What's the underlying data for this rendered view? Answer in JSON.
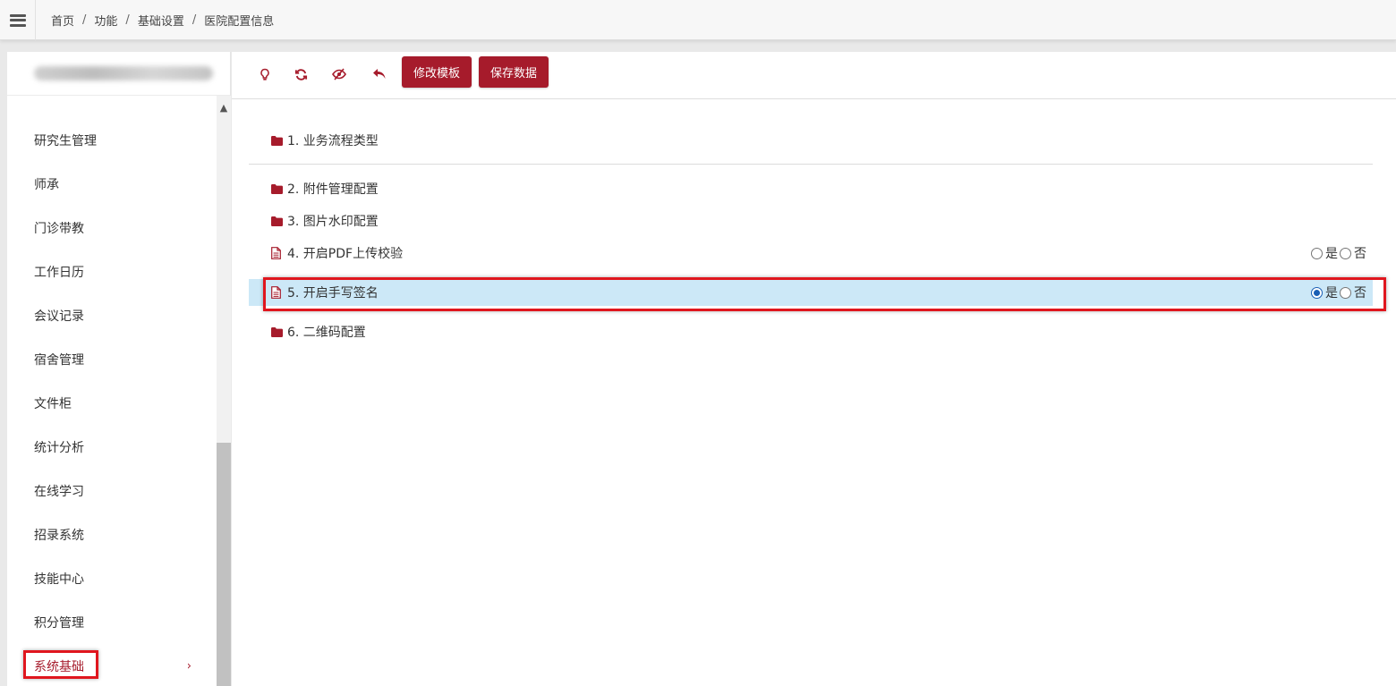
{
  "breadcrumb": [
    {
      "label": "首页"
    },
    {
      "label": "功能"
    },
    {
      "label": "基础设置"
    },
    {
      "label": "医院配置信息"
    }
  ],
  "breadcrumb_separator": "/",
  "sidebar": {
    "items": [
      {
        "label": "研究生管理"
      },
      {
        "label": "师承"
      },
      {
        "label": "门诊带教"
      },
      {
        "label": "工作日历"
      },
      {
        "label": "会议记录"
      },
      {
        "label": "宿舍管理"
      },
      {
        "label": "文件柜"
      },
      {
        "label": "统计分析"
      },
      {
        "label": "在线学习"
      },
      {
        "label": "招录系统"
      },
      {
        "label": "技能中心"
      },
      {
        "label": "积分管理"
      },
      {
        "label": "系统基础",
        "active": true
      }
    ],
    "active_chevron": "›",
    "scroll_up": "▲"
  },
  "toolbar": {
    "icons": [
      "lightbulb-icon",
      "refresh-icon",
      "eye-off-icon",
      "undo-icon"
    ],
    "edit_template_label": "修改模板",
    "save_data_label": "保存数据"
  },
  "tree": {
    "items": [
      {
        "label": "1. 业务流程类型",
        "icon": "folder-icon"
      },
      {
        "label": "2. 附件管理配置",
        "icon": "folder-icon"
      },
      {
        "label": "3. 图片水印配置",
        "icon": "folder-icon"
      },
      {
        "label": "4. 开启PDF上传校验",
        "icon": "document-icon",
        "yes": "是",
        "no": "否",
        "value": null
      },
      {
        "label": "5. 开启手写签名",
        "icon": "document-icon",
        "yes": "是",
        "no": "否",
        "value": "是",
        "selected": true
      },
      {
        "label": "6. 二维码配置",
        "icon": "folder-icon"
      }
    ]
  },
  "colors": {
    "brand": "#a61b2b",
    "selected_row": "#cce8f7",
    "annotation": "#e0161e"
  }
}
